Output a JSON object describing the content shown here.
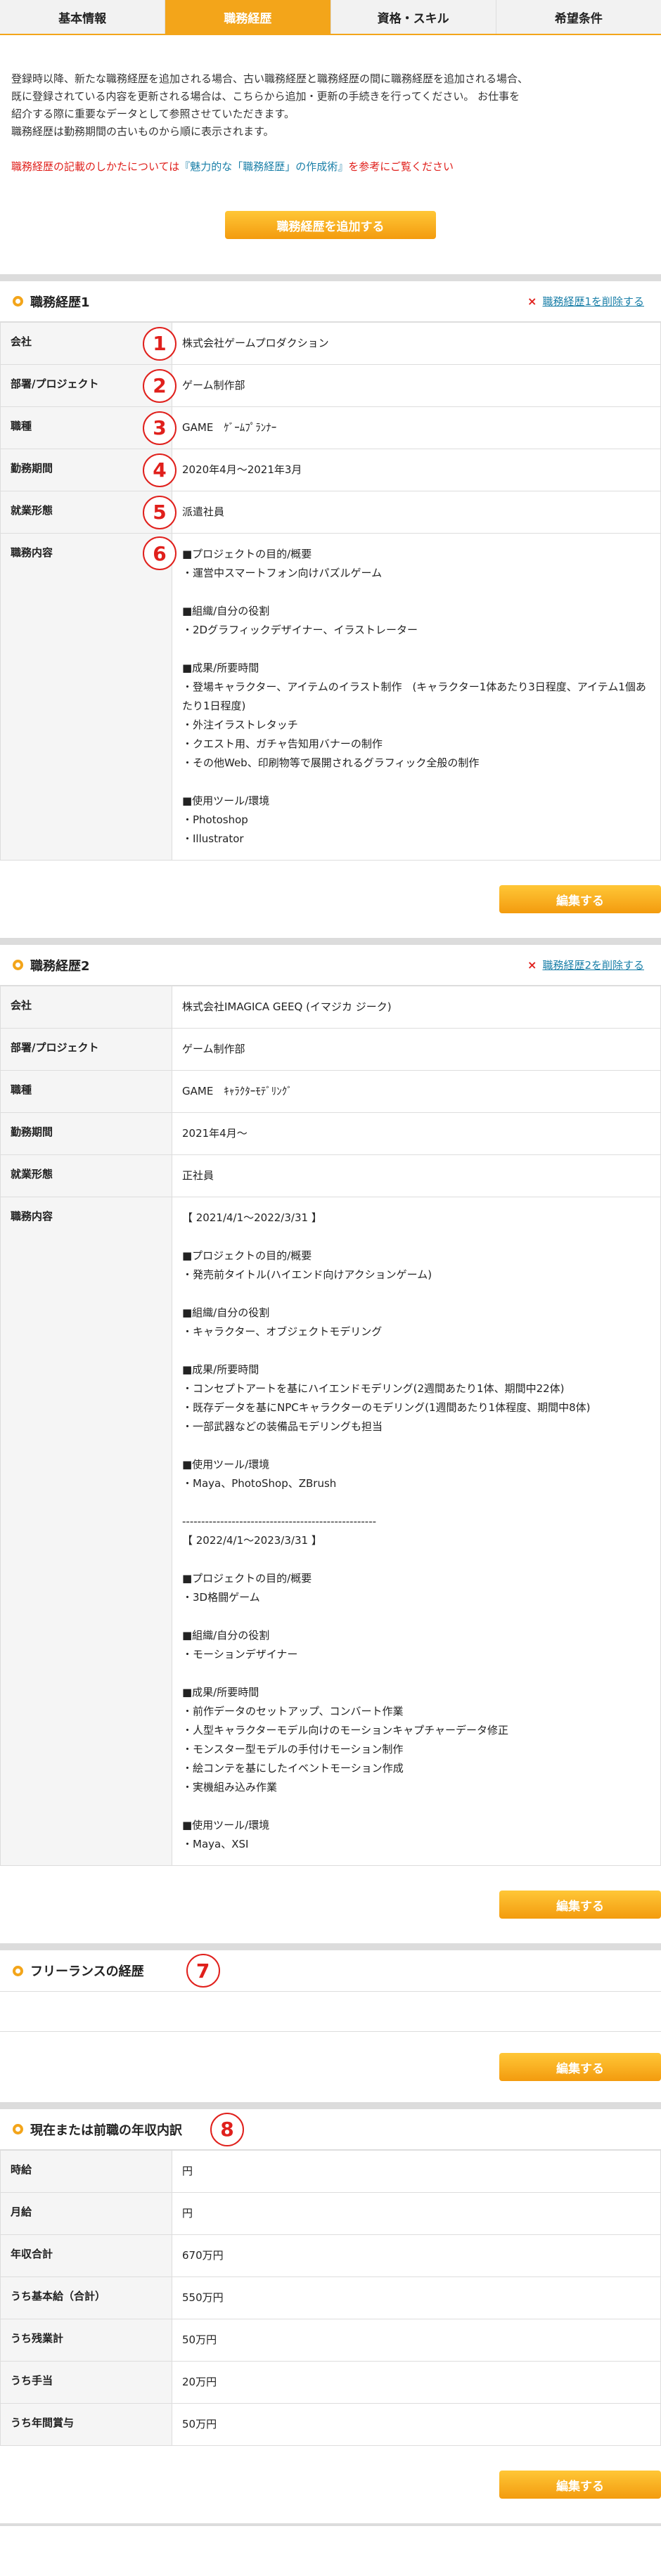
{
  "tabs": [
    "基本情報",
    "職務経歴",
    "資格・スキル",
    "希望条件"
  ],
  "intro": {
    "lines": [
      "登録時以降、新たな職務経歴を追加される場合、古い職務経歴と職務経歴の間に職務経歴を追加される場合、",
      "既に登録されている内容を更新される場合は、こちらから追加・更新の手続きを行ってください。 お仕事を",
      "紹介する際に重要なデータとして参照させていただきます。",
      "職務経歴は勤務期間の古いものから順に表示されます。"
    ],
    "guide_before": "職務経歴の記載のしかたについては",
    "guide_link": "『魅力的な「職務経歴」の作成術』",
    "guide_after": "を参考にご覧ください",
    "add_button": "職務経歴を追加する"
  },
  "labels": {
    "company": "会社",
    "dept": "部署/プロジェクト",
    "job": "職種",
    "period": "勤務期間",
    "employment": "就業形態",
    "content": "職務内容"
  },
  "edit_label": "編集する",
  "delete_icon": "×",
  "career1": {
    "title": "職務経歴1",
    "delete": "職務経歴1を削除する",
    "company": "株式会社ゲームプロダクション",
    "dept": "ゲーム制作部",
    "job": "GAME　ｹﾞｰﾑﾌﾟﾗﾝﾅｰ",
    "period": "2020年4月～2021年3月",
    "employment": "派遣社員",
    "content": "■プロジェクトの目的/概要\n・運営中スマートフォン向けパズルゲーム\n\n■組織/自分の役割\n・2Dグラフィックデザイナー、イラストレーター\n\n■成果/所要時間\n・登場キャラクター、アイテムのイラスト制作　(キャラクター1体あたり3日程度、アイテム1個あたり1日程度)\n・外注イラストレタッチ\n・クエスト用、ガチャ告知用バナーの制作\n・その他Web、印刷物等で展開されるグラフィック全般の制作\n\n■使用ツール/環境\n・Photoshop\n・Illustrator"
  },
  "career2": {
    "title": "職務経歴2",
    "delete": "職務経歴2を削除する",
    "company": "株式会社IMAGICA GEEQ (イマジカ ジーク)",
    "dept": "ゲーム制作部",
    "job": "GAME　ｷｬﾗｸﾀｰﾓﾃﾞﾘﾝｸﾞ",
    "period": "2021年4月～",
    "employment": "正社員",
    "content": "【 2021/4/1～2022/3/31 】\n\n■プロジェクトの目的/概要\n・発売前タイトル(ハイエンド向けアクションゲーム)\n\n■組織/自分の役割\n・キャラクター、オブジェクトモデリング\n\n■成果/所要時間\n・コンセプトアートを基にハイエンドモデリング(2週間あたり1体、期間中22体)\n・既存データを基にNPCキャラクターのモデリング(1週間あたり1体程度、期間中8体)\n・一部武器などの装備品モデリングも担当\n\n■使用ツール/環境\n・Maya、PhotoShop、ZBrush\n\n---------------------------------------------------\n【 2022/4/1～2023/3/31 】\n\n■プロジェクトの目的/概要\n・3D格闘ゲーム\n\n■組織/自分の役割\n・モーションデザイナー\n\n■成果/所要時間\n・前作データのセットアップ、コンバート作業\n・人型キャラクターモデル向けのモーションキャプチャーデータ修正\n・モンスター型モデルの手付けモーション制作\n・絵コンテを基にしたイベントモーション作成\n・実機組み込み作業\n\n■使用ツール/環境\n・Maya、XSI"
  },
  "freelance": {
    "title": "フリーランスの経歴"
  },
  "income": {
    "title": "現在または前職の年収内訳",
    "rows": [
      {
        "label": "時給",
        "value": "円"
      },
      {
        "label": "月給",
        "value": "円"
      },
      {
        "label": "年収合計",
        "value": "670万円"
      },
      {
        "label": "うち基本給（合計）",
        "value": "550万円"
      },
      {
        "label": "うち残業計",
        "value": "50万円"
      },
      {
        "label": "うち手当",
        "value": "20万円"
      },
      {
        "label": "うち年間賞与",
        "value": "50万円"
      }
    ]
  },
  "markers": [
    "1",
    "2",
    "3",
    "4",
    "5",
    "6",
    "7",
    "8"
  ],
  "colors": {
    "accent": "#f3a51a",
    "marker": "#e0201c",
    "link": "#1a7fa8"
  }
}
